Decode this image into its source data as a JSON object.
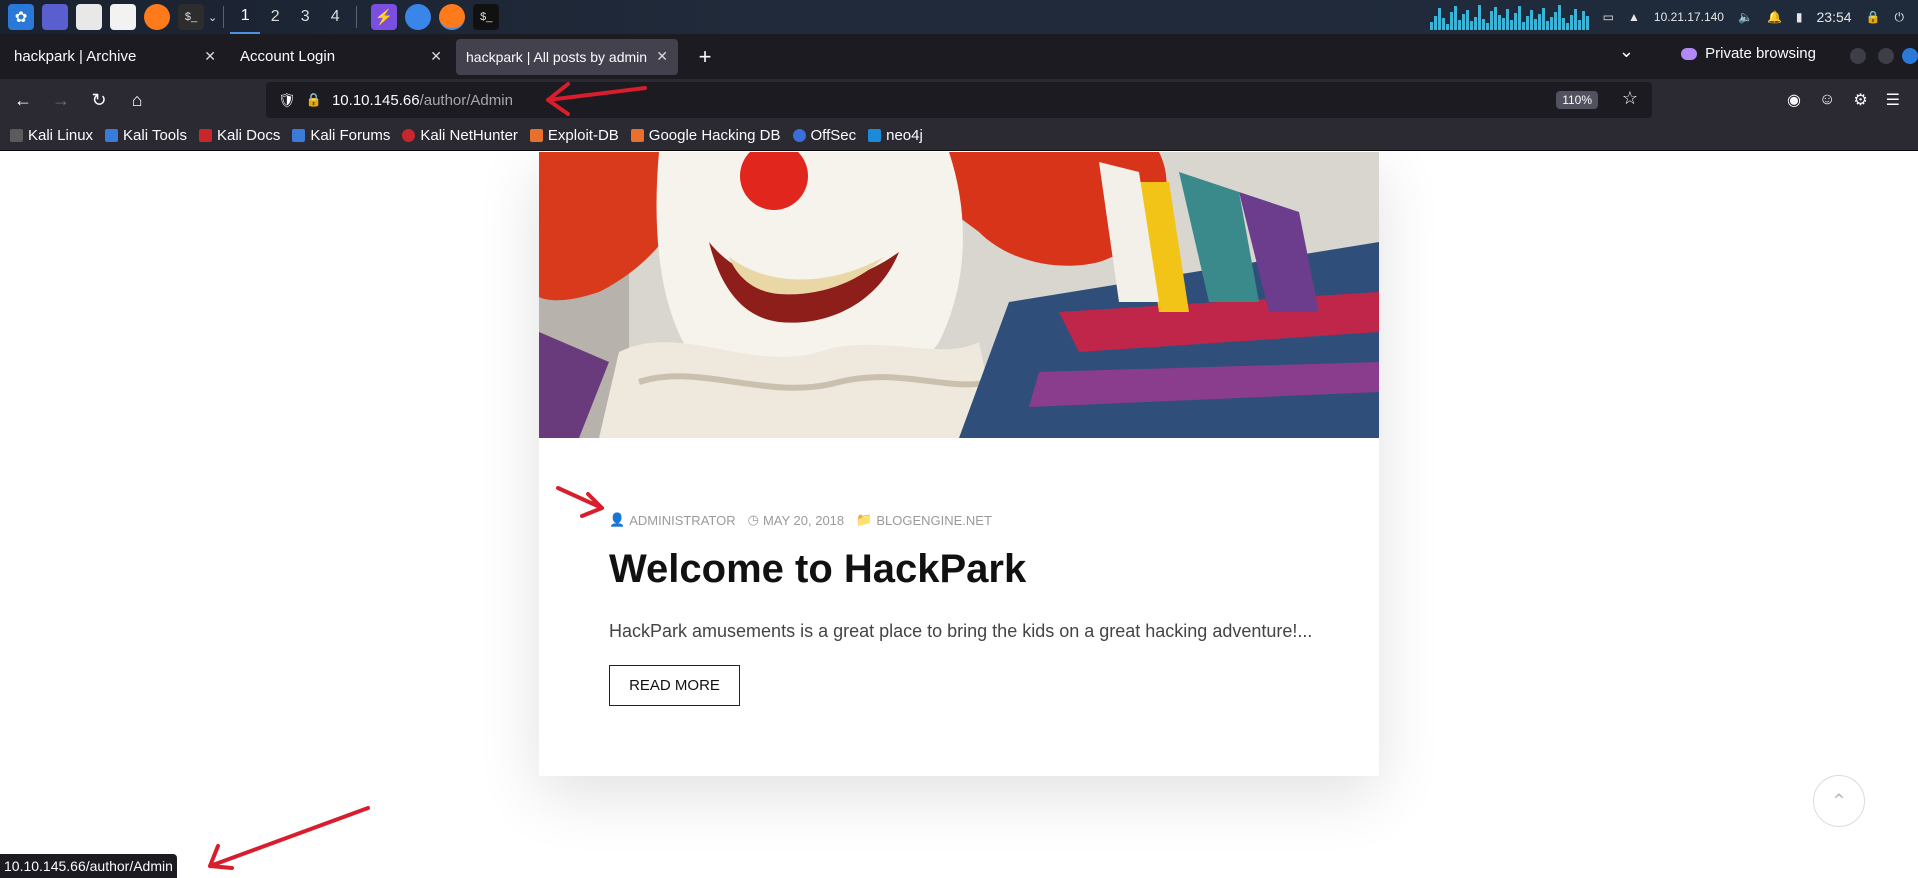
{
  "taskbar": {
    "workspaces": [
      "1",
      "2",
      "3",
      "4"
    ],
    "ip": "10.21.17.140",
    "clock": "23:54"
  },
  "tabs": [
    {
      "label": "hackpark | Archive"
    },
    {
      "label": "Account Login"
    },
    {
      "label": "hackpark | All posts by admin"
    }
  ],
  "window": {
    "private_label": "Private browsing"
  },
  "urlbar": {
    "host": "10.10.145.66",
    "path": "/author/Admin",
    "zoom": "110%"
  },
  "bookmarks": [
    {
      "label": "Kali Linux",
      "color": "#5b5b5b"
    },
    {
      "label": "Kali Tools",
      "color": "#3b7bd8"
    },
    {
      "label": "Kali Docs",
      "color": "#c8262c"
    },
    {
      "label": "Kali Forums",
      "color": "#3b7bd8"
    },
    {
      "label": "Kali NetHunter",
      "color": "#c8262c"
    },
    {
      "label": "Exploit-DB",
      "color": "#e8702a"
    },
    {
      "label": "Google Hacking DB",
      "color": "#e8702a"
    },
    {
      "label": "OffSec",
      "color": "#3a6fd8"
    },
    {
      "label": "neo4j",
      "color": "#1a8bd8"
    }
  ],
  "post": {
    "author": "ADMINISTRATOR",
    "date": "MAY 20, 2018",
    "category": "BLOGENGINE.NET",
    "title": "Welcome to HackPark",
    "excerpt": "HackPark amusements is a great place to bring the kids on a great hacking adventure!...",
    "read_more": "READ MORE"
  },
  "status_link": "10.10.145.66/author/Admin",
  "colors": {
    "annotation": "#d81e2c",
    "accent": "#4f8fe0"
  }
}
